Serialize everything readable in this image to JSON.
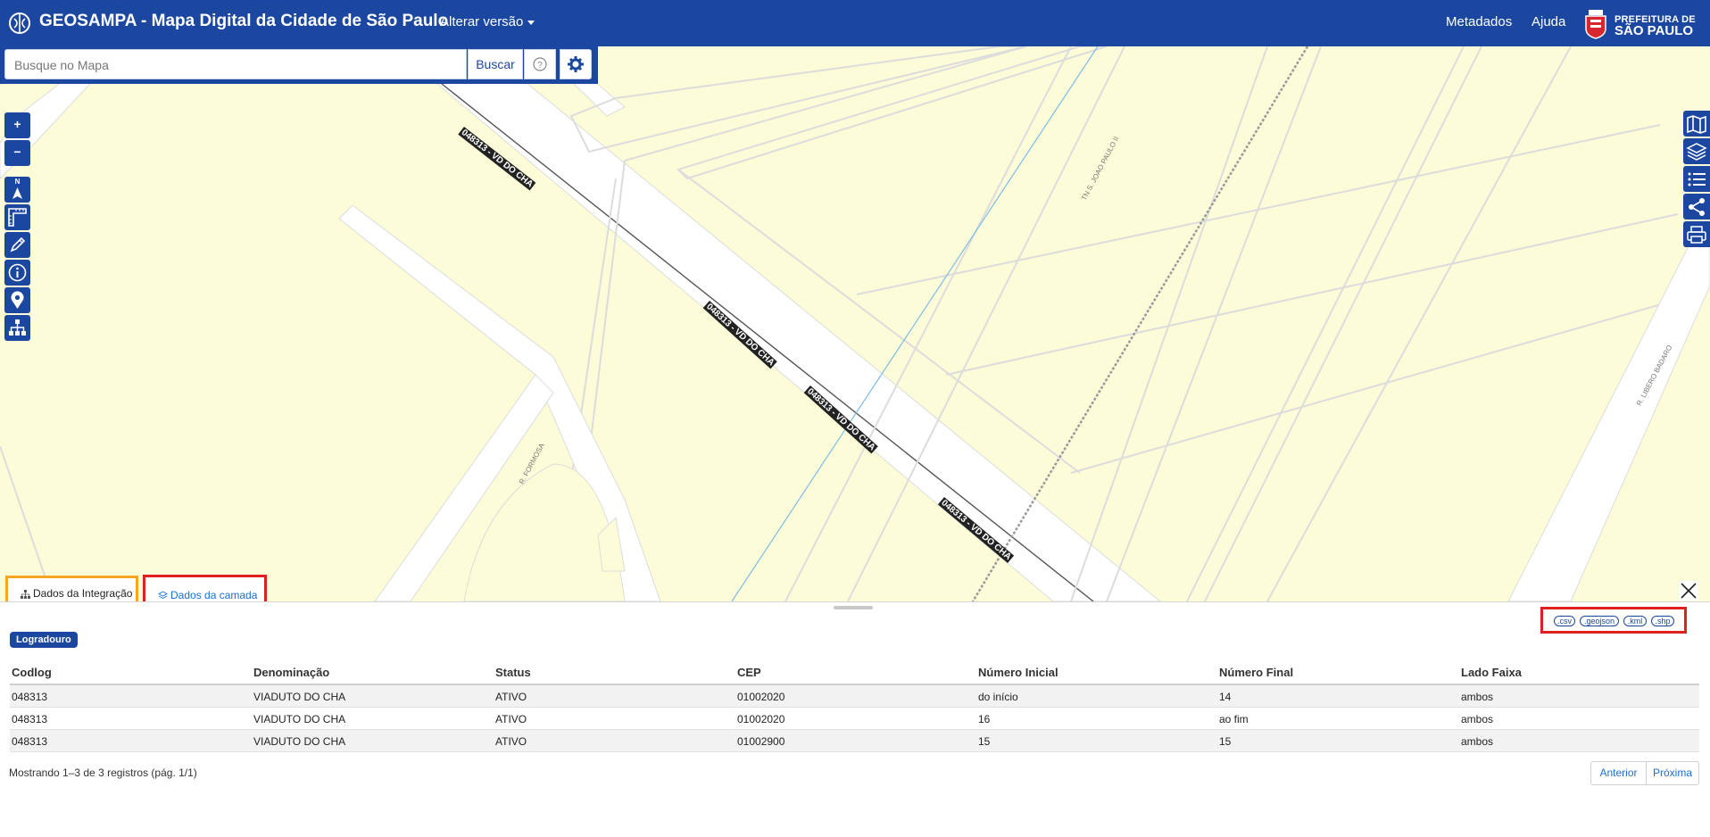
{
  "header": {
    "title": "GEOSAMPA - Mapa Digital da Cidade de São Paulo",
    "version_menu": "Alterar versão",
    "links": [
      "Metadados",
      "Ajuda"
    ],
    "brand_top": "PREFEITURA DE",
    "brand_bottom": "SÃO PAULO"
  },
  "search": {
    "placeholder": "Busque no Mapa",
    "button": "Buscar"
  },
  "map_tools": {
    "zoom_in": "+",
    "zoom_out": "−",
    "north_label": "N"
  },
  "map_labels": {
    "street_1": "048313 - VD DO CHA",
    "street_2": "048313 - VD DO CHA",
    "street_3": "048313 - VD DO CHA",
    "street_4": "048313 - VD DO CHA",
    "joao_paulo": "TN S. JOAO PAULO II",
    "formosa": "R. FORMOSA",
    "libero": "R. LIBERO BADARO"
  },
  "tabs": {
    "integration": "Dados da Integração",
    "layer": "Dados da camada"
  },
  "exports": [
    ".csv",
    ".geojson",
    ".kml",
    ".shp"
  ],
  "badge": "Logradouro",
  "table": {
    "headers": [
      "Codlog",
      "Denominação",
      "Status",
      "CEP",
      "Número Inicial",
      "Número Final",
      "Lado Faixa"
    ],
    "rows": [
      [
        "048313",
        "VIADUTO DO CHA",
        "ATIVO",
        "01002020",
        "do início",
        "14",
        "ambos"
      ],
      [
        "048313",
        "VIADUTO DO CHA",
        "ATIVO",
        "01002020",
        "16",
        "ao fim",
        "ambos"
      ],
      [
        "048313",
        "VIADUTO DO CHA",
        "ATIVO",
        "01002900",
        "15",
        "15",
        "ambos"
      ]
    ]
  },
  "footer": {
    "info": "Mostrando 1–3 de 3 registros (pág. 1/1)",
    "prev": "Anterior",
    "next": "Próxima"
  },
  "colors": {
    "brand_blue": "#1c47a0",
    "map_background": "#fdfcd9",
    "highlight_orange": "#f5a623",
    "highlight_red": "#e02020"
  }
}
